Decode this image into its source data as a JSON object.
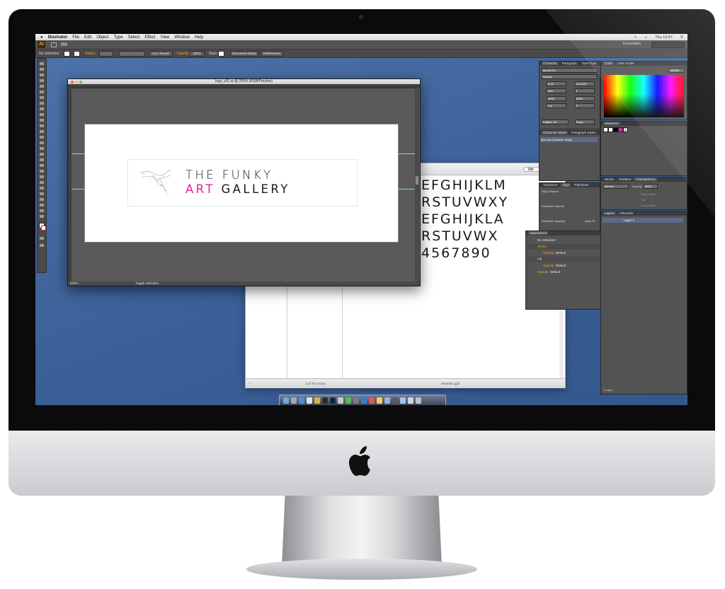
{
  "menubar": {
    "app_name": "Illustrator",
    "items": [
      "File",
      "Edit",
      "Object",
      "Type",
      "Select",
      "Effect",
      "View",
      "Window",
      "Help"
    ],
    "clock": "Thu 13:57"
  },
  "appbar": {
    "workspace": "Essentials"
  },
  "controlbar": {
    "selection": "No Selection",
    "stroke_label": "Stroke:",
    "stroke_style": "5 pt. Round",
    "opacity_label": "Opacity:",
    "opacity_value": "100%",
    "style_label": "Style:",
    "document_setup": "Document Setup",
    "preferences": "Preferences"
  },
  "document": {
    "title": "logo_v01.ai @ 200% (RGB/Preview)",
    "zoom": "200%",
    "status": "Toggle Selection",
    "logo_line1": "THE FUNKY",
    "logo_line2_accent": "ART",
    "logo_line2_rest": "GALLERY"
  },
  "fontbook": {
    "search": "ldfe",
    "samples": [
      "EFGHIJKLM",
      "RSTUVWXY",
      "EFGHIJKLA",
      "RSTUVWX",
      "4567890"
    ],
    "count": "1 of 701 Fonts",
    "font_name": "Wheeld Light"
  },
  "character_panel": {
    "tabs": [
      "Character",
      "Paragraph",
      "OpenType"
    ],
    "font": "Norval Pro",
    "style": "Regular",
    "size": "12 pt",
    "leading": "(14.4 pt)",
    "kerning": "Auto",
    "tracking": "0",
    "hscale": "100%",
    "vscale": "100%",
    "baseline": "0 pt",
    "rotation": "0°",
    "language": "English: UK",
    "aa": "Sharp"
  },
  "character_styles": {
    "tabs": [
      "Character Styles",
      "Paragraph Styles"
    ],
    "item": "[Normal Character Style]"
  },
  "color_panel": {
    "tabs": [
      "Color",
      "Color Guide"
    ],
    "hex": "000000"
  },
  "swatches": {
    "title": "Swatches"
  },
  "transparency": {
    "tabs": [
      "Stroke",
      "Gradient",
      "Transparency"
    ],
    "mode": "Normal",
    "opacity_label": "Opacity:",
    "opacity": "100%",
    "make_mask": "Make Mask",
    "clip": "Clip",
    "invert": "Invert Mask"
  },
  "align_panel": {
    "tabs": [
      "Transform",
      "Align",
      "Pathfinder"
    ],
    "align_objects": "Align Objects:",
    "distribute_objects": "Distribute Objects:",
    "distribute_spacing": "Distribute Spacing:",
    "align_to": "Align To:"
  },
  "appearance": {
    "title": "Appearance",
    "selection": "No Selection",
    "stroke": "Stroke:",
    "fill": "Fill:",
    "opacity": "Opacity:",
    "default": "Default"
  },
  "layers": {
    "tabs": [
      "Layers",
      "Artboards"
    ],
    "layer": "Layer 1",
    "footer": "1 Layer"
  },
  "colors": {
    "accent_pink": "#e4239c",
    "ai_orange": "#f7a71c",
    "panel": "#535353",
    "desktop": "#3a5e96"
  }
}
